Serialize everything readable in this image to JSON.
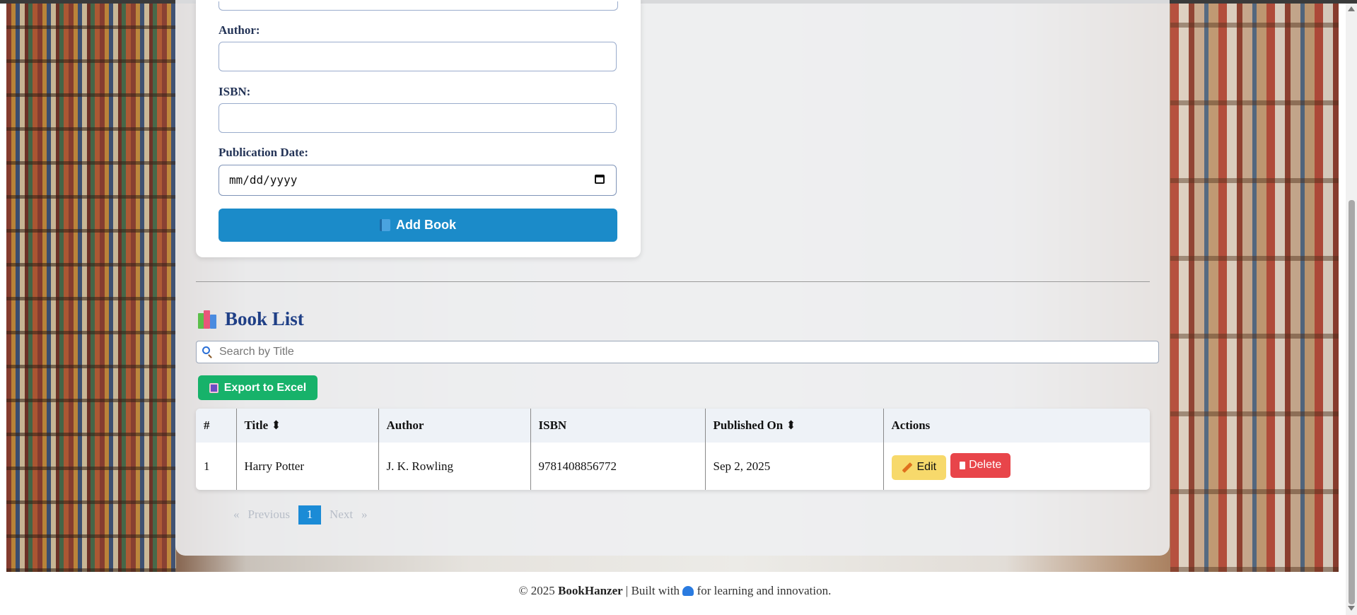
{
  "form": {
    "author_label": "Author:",
    "isbn_label": "ISBN:",
    "pubdate_label": "Publication Date:",
    "pubdate_value": "mm/dd/yyyy",
    "add_button": "Add Book"
  },
  "book_list": {
    "title": "Book List",
    "search_placeholder": "Search by Title",
    "export_button": "Export to Excel",
    "columns": [
      "#",
      "Title ⬍",
      "Author",
      "ISBN",
      "Published On ⬍",
      "Actions"
    ],
    "rows": [
      {
        "num": "1",
        "title": "Harry Potter",
        "author": "J. K. Rowling",
        "isbn": "9781408856772",
        "published": "Sep 2, 2025"
      }
    ],
    "edit_label": "Edit",
    "delete_label": "Delete"
  },
  "pagination": {
    "first": "«",
    "previous": "Previous",
    "current": "1",
    "next": "Next",
    "last": "»"
  },
  "footer": {
    "copyright": "© 2025",
    "brand": "BookHanzer",
    "built_with": "| Built with",
    "tail": "for learning and innovation."
  },
  "colors": {
    "primary": "#1b8bc9",
    "success": "#17b26a",
    "warning": "#f7d96b",
    "danger": "#e8454a",
    "heading": "#1f3f86"
  }
}
